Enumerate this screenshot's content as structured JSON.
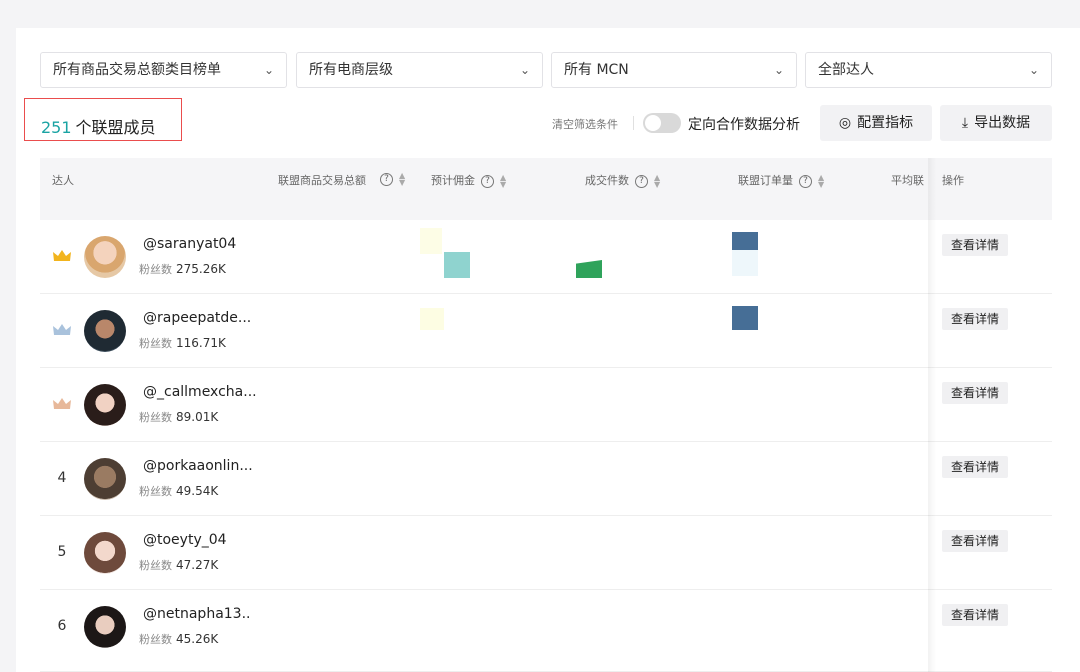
{
  "filters": [
    {
      "label": "所有商品交易总额类目榜单"
    },
    {
      "label": "所有电商层级"
    },
    {
      "label": "所有 MCN"
    },
    {
      "label": "全部达人"
    }
  ],
  "summary": {
    "count": "251",
    "count_label": "个联盟成员"
  },
  "toolbar": {
    "clear_label": "清空筛选条件",
    "toggle_label": "定向合作数据分析",
    "config_label": "配置指标",
    "export_label": "导出数据"
  },
  "table": {
    "headers": {
      "creator": "达人",
      "gmv": "联盟商品交易总额",
      "commission": "预计佣金",
      "deals": "成交件数",
      "orders": "联盟订单量",
      "avg": "平均联",
      "action": "操作"
    },
    "rows": [
      {
        "rank": "",
        "crown": "gold",
        "name": "@saranyat04",
        "fans_label": "粉丝数",
        "fans": "275.26K",
        "action": "查看详情"
      },
      {
        "rank": "",
        "crown": "silver",
        "name": "@rapeepatde...",
        "fans_label": "粉丝数",
        "fans": "116.71K",
        "action": "查看详情"
      },
      {
        "rank": "",
        "crown": "bronze",
        "name": "@_callmexcha...",
        "fans_label": "粉丝数",
        "fans": "89.01K",
        "action": "查看详情"
      },
      {
        "rank": "4",
        "crown": "",
        "name": "@porkaaonlin...",
        "fans_label": "粉丝数",
        "fans": "49.54K",
        "action": "查看详情"
      },
      {
        "rank": "5",
        "crown": "",
        "name": "@toeyty_04",
        "fans_label": "粉丝数",
        "fans": "47.27K",
        "action": "查看详情"
      },
      {
        "rank": "6",
        "crown": "",
        "name": "@netnapha13..",
        "fans_label": "粉丝数",
        "fans": "45.26K",
        "action": "查看详情"
      }
    ]
  },
  "colors": {
    "accent": "#1aa3a3",
    "highlight_border": "#ea4d4d"
  }
}
